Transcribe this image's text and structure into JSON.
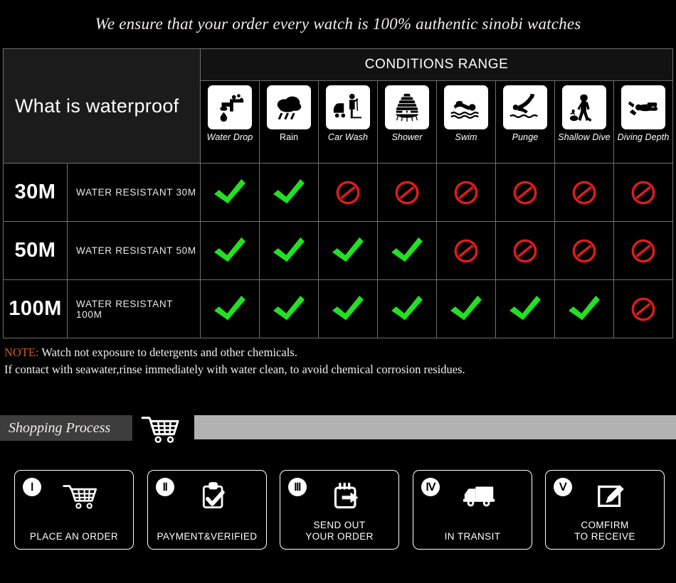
{
  "banner": {
    "text": "We ensure that your order every watch is 100% authentic sinobi watches"
  },
  "table": {
    "left_header": "What is waterproof",
    "conditions_range_title": "CONDITIONS RANGE",
    "conditions": [
      {
        "label": "Water Drop",
        "icon": "faucet-drip-icon",
        "italic": true
      },
      {
        "label": "Rain",
        "icon": "rain-cloud-icon",
        "italic": false
      },
      {
        "label": "Car Wash",
        "icon": "car-wash-icon",
        "italic": true
      },
      {
        "label": "Shower",
        "icon": "shower-icon",
        "italic": true
      },
      {
        "label": "Swim",
        "icon": "swimmer-icon",
        "italic": true
      },
      {
        "label": "Punge",
        "icon": "plunge-dive-icon",
        "italic": true
      },
      {
        "label": "Shallow Dive",
        "icon": "shallow-dive-icon",
        "italic": true
      },
      {
        "label": "Diving Depth",
        "icon": "scuba-diver-icon",
        "italic": true
      }
    ],
    "rows": [
      {
        "depth": "30M",
        "description": "WATER RESISTANT  30M",
        "marks": [
          "yes",
          "yes",
          "no",
          "no",
          "no",
          "no",
          "no",
          "no"
        ]
      },
      {
        "depth": "50M",
        "description": "WATER RESISTANT 50M",
        "marks": [
          "yes",
          "yes",
          "yes",
          "yes",
          "no",
          "no",
          "no",
          "no"
        ]
      },
      {
        "depth": "100M",
        "description": "WATER RESISTANT  100M",
        "marks": [
          "yes",
          "yes",
          "yes",
          "yes",
          "yes",
          "yes",
          "yes",
          "no"
        ]
      }
    ]
  },
  "note": {
    "tag": "NOTE:",
    "line1": " Watch not exposure to detergents and other chemicals.",
    "line2": "If contact with seawater,rinse immediately with water clean, to avoid chemical corrosion residues."
  },
  "shopping_process": {
    "label": "Shopping Process",
    "cart_icon": "shopping-cart-icon"
  },
  "steps": [
    {
      "numeral": "Ⅰ",
      "icon": "shopping-cart-icon",
      "label_line1": "PLACE AN ORDER",
      "label_line2": ""
    },
    {
      "numeral": "Ⅱ",
      "icon": "clipboard-check-icon",
      "label_line1": "PAYMENT&VERIFIED",
      "label_line2": ""
    },
    {
      "numeral": "Ⅲ",
      "icon": "calendar-arrow-out-icon",
      "label_line1": "SEND OUT",
      "label_line2": "YOUR ORDER"
    },
    {
      "numeral": "Ⅳ",
      "icon": "delivery-truck-icon",
      "label_line1": "IN TRANSIT",
      "label_line2": ""
    },
    {
      "numeral": "Ⅴ",
      "icon": "pencil-square-icon",
      "label_line1": "COMFIRM",
      "label_line2": "TO RECEIVE"
    }
  ],
  "colors": {
    "check_green": "#22e022",
    "no_red": "#e01b1b",
    "note_tag": "#cf5a22",
    "border": "#6f6f6f",
    "gray_bar": "#b2b2b2",
    "label_bar": "#3d3d3d"
  }
}
